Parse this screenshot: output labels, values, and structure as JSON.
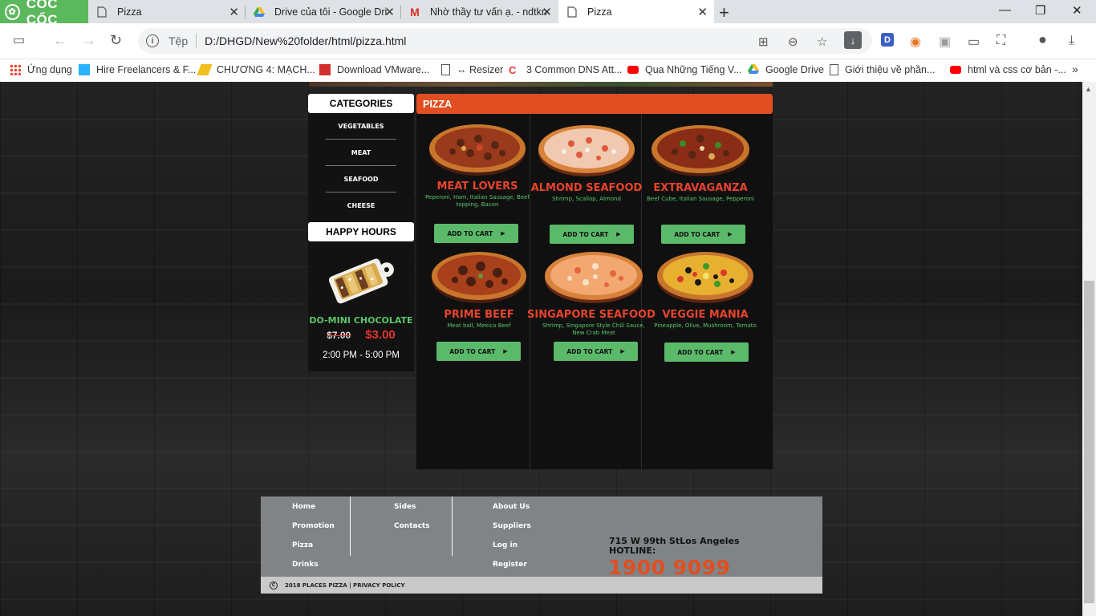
{
  "browser": {
    "brand": "CỐC CỐC",
    "tabs": [
      {
        "title": "Pizza"
      },
      {
        "title": "Drive của tôi - Google Dri"
      },
      {
        "title": "Nhờ thầy tư vấn ạ. - ndtkn"
      },
      {
        "title": "Pizza"
      }
    ],
    "address": {
      "scheme": "Tệp",
      "url": "D:/DHGD/New%20folder/html/pizza.html"
    },
    "bookmarks": [
      {
        "label": "Ứng dụng"
      },
      {
        "label": "Hire Freelancers & F..."
      },
      {
        "label": "CHƯƠNG 4: MẠCH..."
      },
      {
        "label": "Download VMware..."
      },
      {
        "label": "↔ Resizer"
      },
      {
        "label": "3 Common DNS Att..."
      },
      {
        "label": "Qua Những Tiếng V..."
      },
      {
        "label": "Google Drive"
      },
      {
        "label": "Giới thiệu về phần..."
      },
      {
        "label": "html và css cơ bản -..."
      }
    ],
    "colors": {
      "brand": "#5cb85c",
      "tabbar": "#dee1e6"
    }
  },
  "sidebar": {
    "categories_title": "CATEGORIES",
    "categories": [
      "VEGETABLES",
      "MEAT",
      "SEAFOOD",
      "CHEESE"
    ],
    "happy_hours_title": "HAPPY HOURS",
    "promo": {
      "name": "DO-MINI CHOCOLATE",
      "old_price": "$7.00",
      "new_price": "$3.00",
      "time": "2:00 PM - 5:00 PM"
    }
  },
  "main": {
    "section_title": "PIZZA",
    "cart_label": "ADD TO CART",
    "pizzas": [
      {
        "name": "MEAT LOVERS",
        "desc": "Peperoni, Ham, Italian Sausage, Beef topping, Bacon"
      },
      {
        "name": "ALMOND SEAFOOD",
        "desc": "Shrimp, Scallop, Almond"
      },
      {
        "name": "EXTRAVAGANZA",
        "desc": "Beef Cube, Italian Sausage, Pepperoni"
      },
      {
        "name": "PRIME BEEF",
        "desc": "Meat ball, Mexico Beef"
      },
      {
        "name": "SINGAPORE SEAFOOD",
        "desc": "Shrimp, Singapore Style Chili Sauce, New Crab Meat"
      },
      {
        "name": "VEGGIE MANIA",
        "desc": "Pineapple, Olive, Mushroom, Tomato"
      }
    ],
    "colors": {
      "accent": "#e04e22",
      "button": "#5bb96a",
      "name": "#e8442c",
      "desc": "#59c86a"
    }
  },
  "footer": {
    "col1": [
      "Home",
      "Promotion",
      "Pizza",
      "Drinks"
    ],
    "col2": [
      "Sides",
      "Contacts"
    ],
    "col3": [
      "About Us",
      "Suppliers",
      "Log in",
      "Register"
    ],
    "address": "715 W 99th StLos Angeles",
    "hotline_label": "HOTLINE:",
    "hotline": "1900 9099",
    "copyright": "2018 PLACES PIZZA | PRIVACY POLICY"
  }
}
